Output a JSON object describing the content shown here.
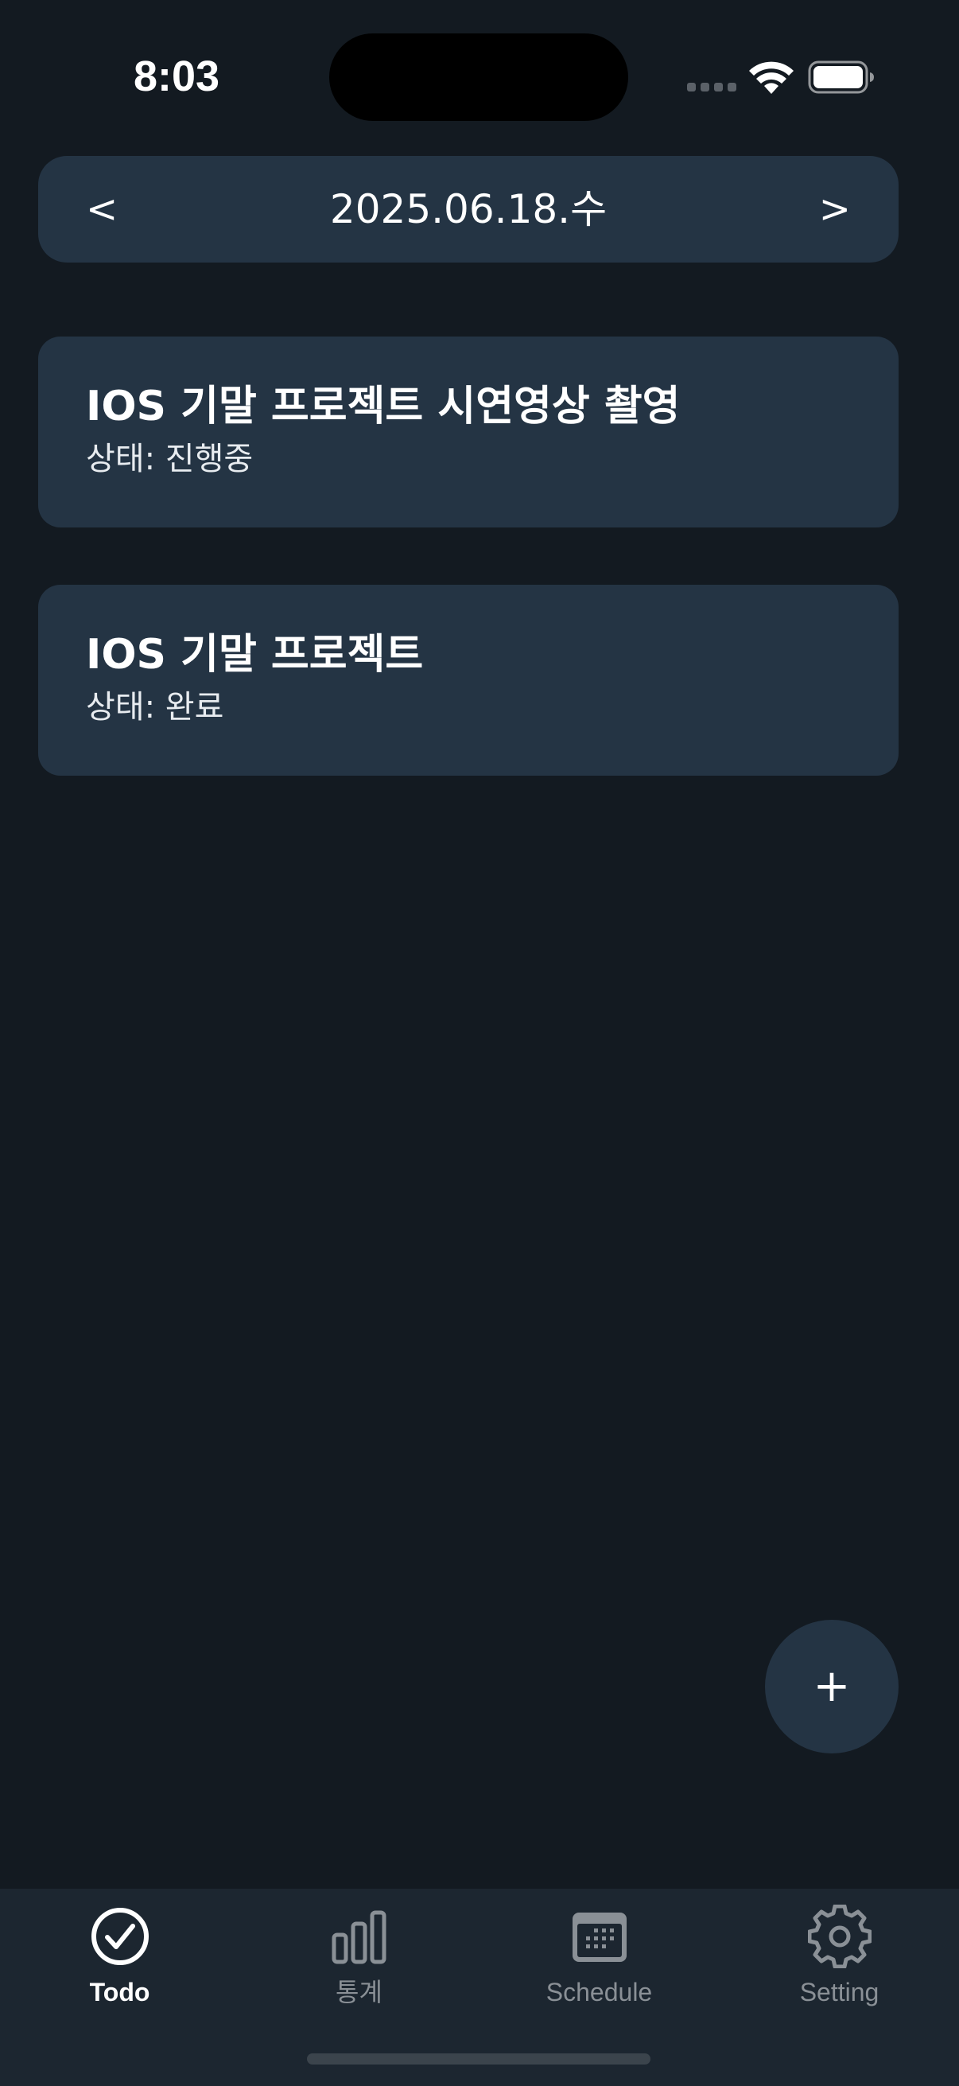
{
  "status_bar": {
    "time": "8:03"
  },
  "date_nav": {
    "prev_label": "<",
    "date": "2025.06.18.수",
    "next_label": ">"
  },
  "todos": [
    {
      "title": "IOS 기말 프로젝트 시연영상 촬영",
      "status": "상태: 진행중"
    },
    {
      "title": "IOS 기말 프로젝트",
      "status": "상태: 완료"
    }
  ],
  "fab": {
    "label": "+"
  },
  "tabs": [
    {
      "label": "Todo",
      "icon": "checkmark-circle-icon",
      "active": true
    },
    {
      "label": "통계",
      "icon": "bar-chart-icon",
      "active": false
    },
    {
      "label": "Schedule",
      "icon": "calendar-icon",
      "active": false
    },
    {
      "label": "Setting",
      "icon": "gear-icon",
      "active": false
    }
  ],
  "colors": {
    "background": "#131a21",
    "card": "#243444",
    "tabbar": "#1c2630",
    "tab_inactive": "#8a9096",
    "tab_active": "#ffffff"
  }
}
